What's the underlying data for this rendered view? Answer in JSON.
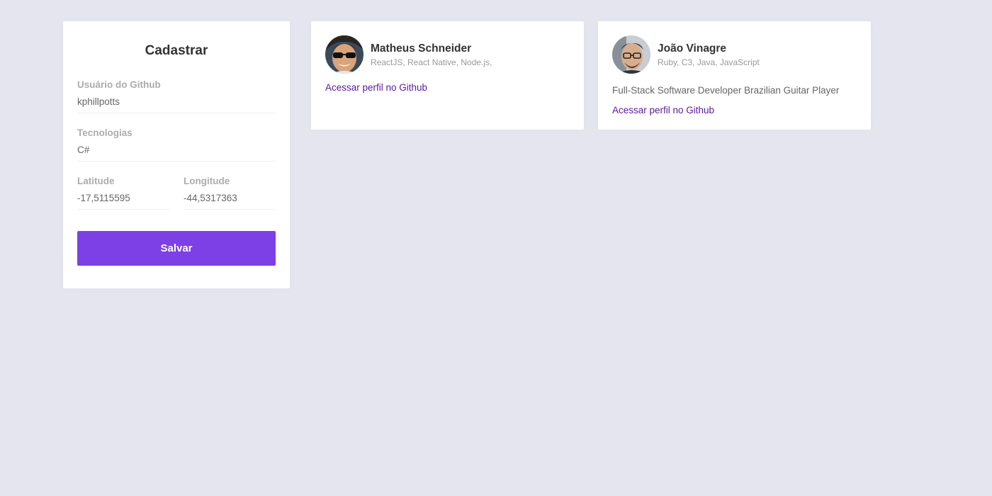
{
  "form": {
    "title": "Cadastrar",
    "github_user": {
      "label": "Usuário do Github",
      "value": "kphillpotts"
    },
    "techs": {
      "label": "Tecnologias",
      "value": "C#"
    },
    "latitude": {
      "label": "Latitude",
      "value": "-17,5115595"
    },
    "longitude": {
      "label": "Longitude",
      "value": "-44,5317363"
    },
    "submit_label": "Salvar"
  },
  "devs": [
    {
      "name": "Matheus Schneider",
      "techs": "ReactJS, React Native, Node.js,",
      "bio": "",
      "link_label": "Acessar perfil no Github"
    },
    {
      "name": "João Vinagre",
      "techs": "Ruby, C3, Java, JavaScript",
      "bio": "Full-Stack Software Developer Brazilian Guitar Player",
      "link_label": "Acessar perfil no Github"
    }
  ],
  "colors": {
    "background": "#e5e5f0",
    "accent": "#7d40e7",
    "link": "#5a1a9a"
  }
}
